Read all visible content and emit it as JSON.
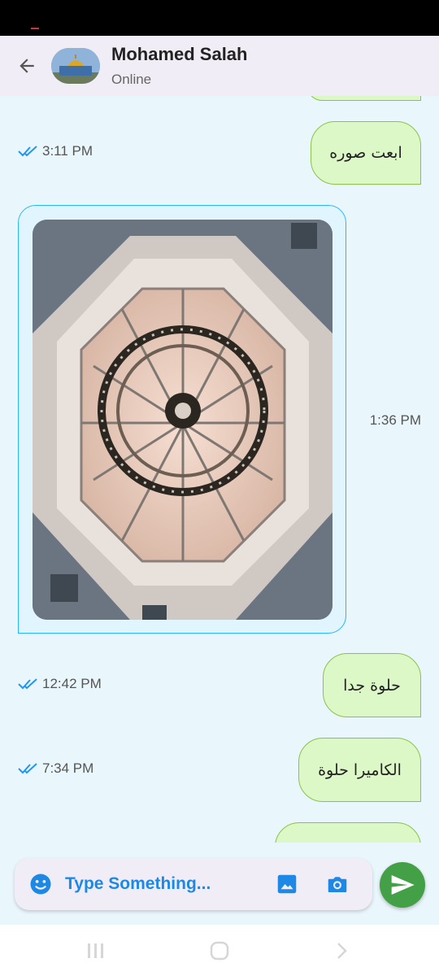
{
  "header": {
    "contact_name": "Mohamed Salah",
    "contact_status": "Online",
    "back_icon": "arrow-back-icon",
    "avatar_icon": "dome-photo-avatar"
  },
  "messages": [
    {
      "direction": "outgoing",
      "text": "ابعت صوره",
      "time": "3:11 PM",
      "status": "read"
    },
    {
      "direction": "incoming",
      "type": "image",
      "image_description_icon": "chandelier-photo",
      "time": "1:36 PM"
    },
    {
      "direction": "outgoing",
      "text": "حلوة جدا",
      "time": "12:42 PM",
      "status": "read"
    },
    {
      "direction": "outgoing",
      "text": "الكاميرا حلوة",
      "time": "7:34 PM",
      "status": "read"
    }
  ],
  "composer": {
    "placeholder": "Type Something...",
    "emoji_icon": "emoji-icon",
    "gallery_icon": "image-icon",
    "camera_icon": "camera-icon",
    "send_icon": "send-icon"
  },
  "colors": {
    "chat_background": "#e9f6fc",
    "outgoing_bubble": "#dcf8c6",
    "outgoing_border": "#8bc34a",
    "incoming_bubble": "#e1f5fe",
    "incoming_border": "#29b6f6",
    "accent_blue": "#1e88e5",
    "send_green": "#43a047",
    "read_tick": "#2196f3"
  },
  "nav": {
    "recents_icon": "recents-icon",
    "home_icon": "home-icon",
    "back_icon": "nav-back-icon"
  }
}
